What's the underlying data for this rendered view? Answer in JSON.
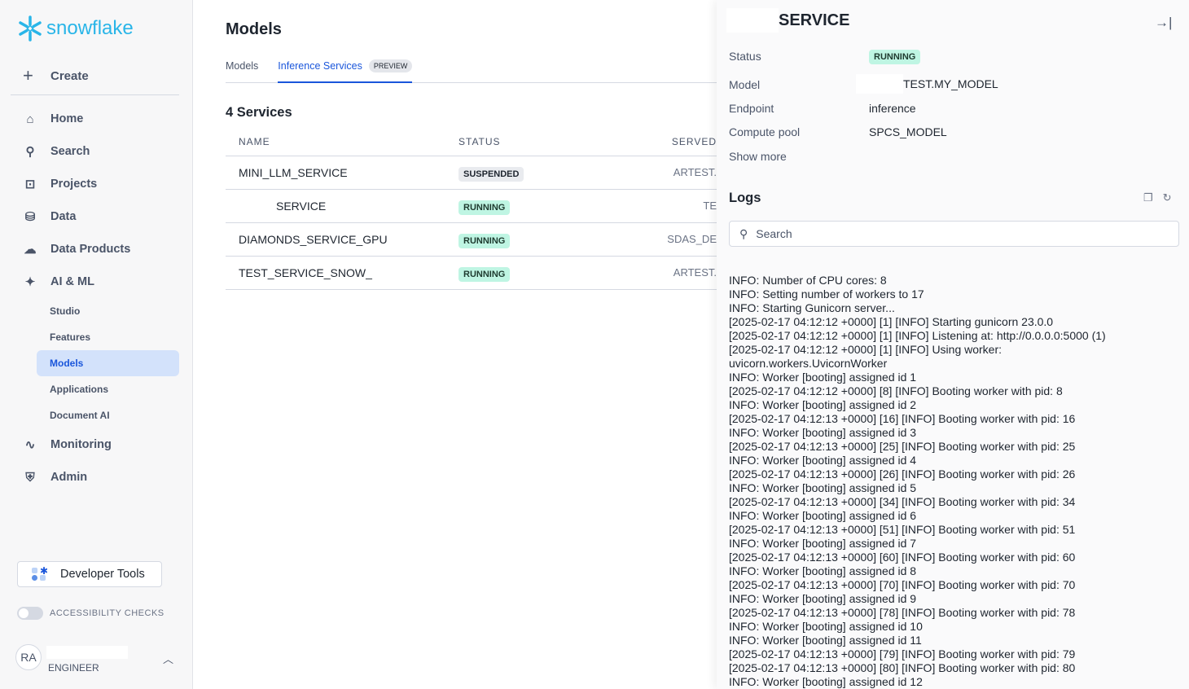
{
  "brand": {
    "name": "snowflake",
    "color": "#29b5e8"
  },
  "sidebar": {
    "create": "Create",
    "items": [
      {
        "label": "Home",
        "icon": "home-icon"
      },
      {
        "label": "Search",
        "icon": "search-icon"
      },
      {
        "label": "Projects",
        "icon": "terminal-icon"
      },
      {
        "label": "Data",
        "icon": "database-icon"
      },
      {
        "label": "Data Products",
        "icon": "cloud-icon"
      },
      {
        "label": "AI & ML",
        "icon": "sparkle-icon"
      }
    ],
    "ai_sub": [
      "Studio",
      "Features",
      "Models",
      "Applications",
      "Document AI"
    ],
    "items2": [
      {
        "label": "Monitoring",
        "icon": "activity-icon"
      },
      {
        "label": "Admin",
        "icon": "shield-icon"
      }
    ],
    "dev_tools": "Developer Tools",
    "accessibility": "ACCESSIBILITY CHECKS",
    "user": {
      "initials": "RA",
      "role": "ENGINEER"
    }
  },
  "main": {
    "title": "Models",
    "tabs": [
      "Models",
      "Inference Services"
    ],
    "preview": "PREVIEW",
    "count": "4 Services",
    "columns": [
      "NAME",
      "STATUS",
      "SERVED"
    ],
    "rows": [
      {
        "name": "MINI_LLM_SERVICE",
        "status": "SUSPENDED",
        "served": "ARTEST."
      },
      {
        "name": "SERVICE",
        "status": "RUNNING",
        "served": "TE"
      },
      {
        "name": "DIAMONDS_SERVICE_GPU",
        "status": "RUNNING",
        "served": "SDAS_DE"
      },
      {
        "name": "TEST_SERVICE_SNOW_",
        "status": "RUNNING",
        "served": "ARTEST."
      }
    ]
  },
  "panel": {
    "title": "SERVICE",
    "fields": [
      {
        "label": "Status",
        "value": "RUNNING"
      },
      {
        "label": "Model",
        "value": "TEST.MY_MODEL"
      },
      {
        "label": "Endpoint",
        "value": "inference"
      },
      {
        "label": "Compute pool",
        "value": "SPCS_MODEL"
      }
    ],
    "show_more": "Show more",
    "logs_title": "Logs",
    "search_placeholder": "Search",
    "log_lines": [
      "INFO: Number of CPU cores: 8",
      "INFO: Setting number of workers to 17",
      "INFO: Starting Gunicorn server...",
      "[2025-02-17 04:12:12 +0000] [1] [INFO] Starting gunicorn 23.0.0",
      "[2025-02-17 04:12:12 +0000] [1] [INFO] Listening at: http://0.0.0.0:5000 (1)",
      "[2025-02-17 04:12:12 +0000] [1] [INFO] Using worker:",
      "uvicorn.workers.UvicornWorker",
      "INFO: Worker [booting] assigned id 1",
      "[2025-02-17 04:12:12 +0000] [8] [INFO] Booting worker with pid: 8",
      "INFO: Worker [booting] assigned id 2",
      "[2025-02-17 04:12:13 +0000] [16] [INFO] Booting worker with pid: 16",
      "INFO: Worker [booting] assigned id 3",
      "[2025-02-17 04:12:13 +0000] [25] [INFO] Booting worker with pid: 25",
      "INFO: Worker [booting] assigned id 4",
      "[2025-02-17 04:12:13 +0000] [26] [INFO] Booting worker with pid: 26",
      "INFO: Worker [booting] assigned id 5",
      "[2025-02-17 04:12:13 +0000] [34] [INFO] Booting worker with pid: 34",
      "INFO: Worker [booting] assigned id 6",
      "[2025-02-17 04:12:13 +0000] [51] [INFO] Booting worker with pid: 51",
      "INFO: Worker [booting] assigned id 7",
      "[2025-02-17 04:12:13 +0000] [60] [INFO] Booting worker with pid: 60",
      "INFO: Worker [booting] assigned id 8",
      "[2025-02-17 04:12:13 +0000] [70] [INFO] Booting worker with pid: 70",
      "INFO: Worker [booting] assigned id 9",
      "[2025-02-17 04:12:13 +0000] [78] [INFO] Booting worker with pid: 78",
      "INFO: Worker [booting] assigned id 10",
      "INFO: Worker [booting] assigned id 11",
      "[2025-02-17 04:12:13 +0000] [79] [INFO] Booting worker with pid: 79",
      "[2025-02-17 04:12:13 +0000] [80] [INFO] Booting worker with pid: 80",
      "INFO: Worker [booting] assigned id 12"
    ]
  }
}
